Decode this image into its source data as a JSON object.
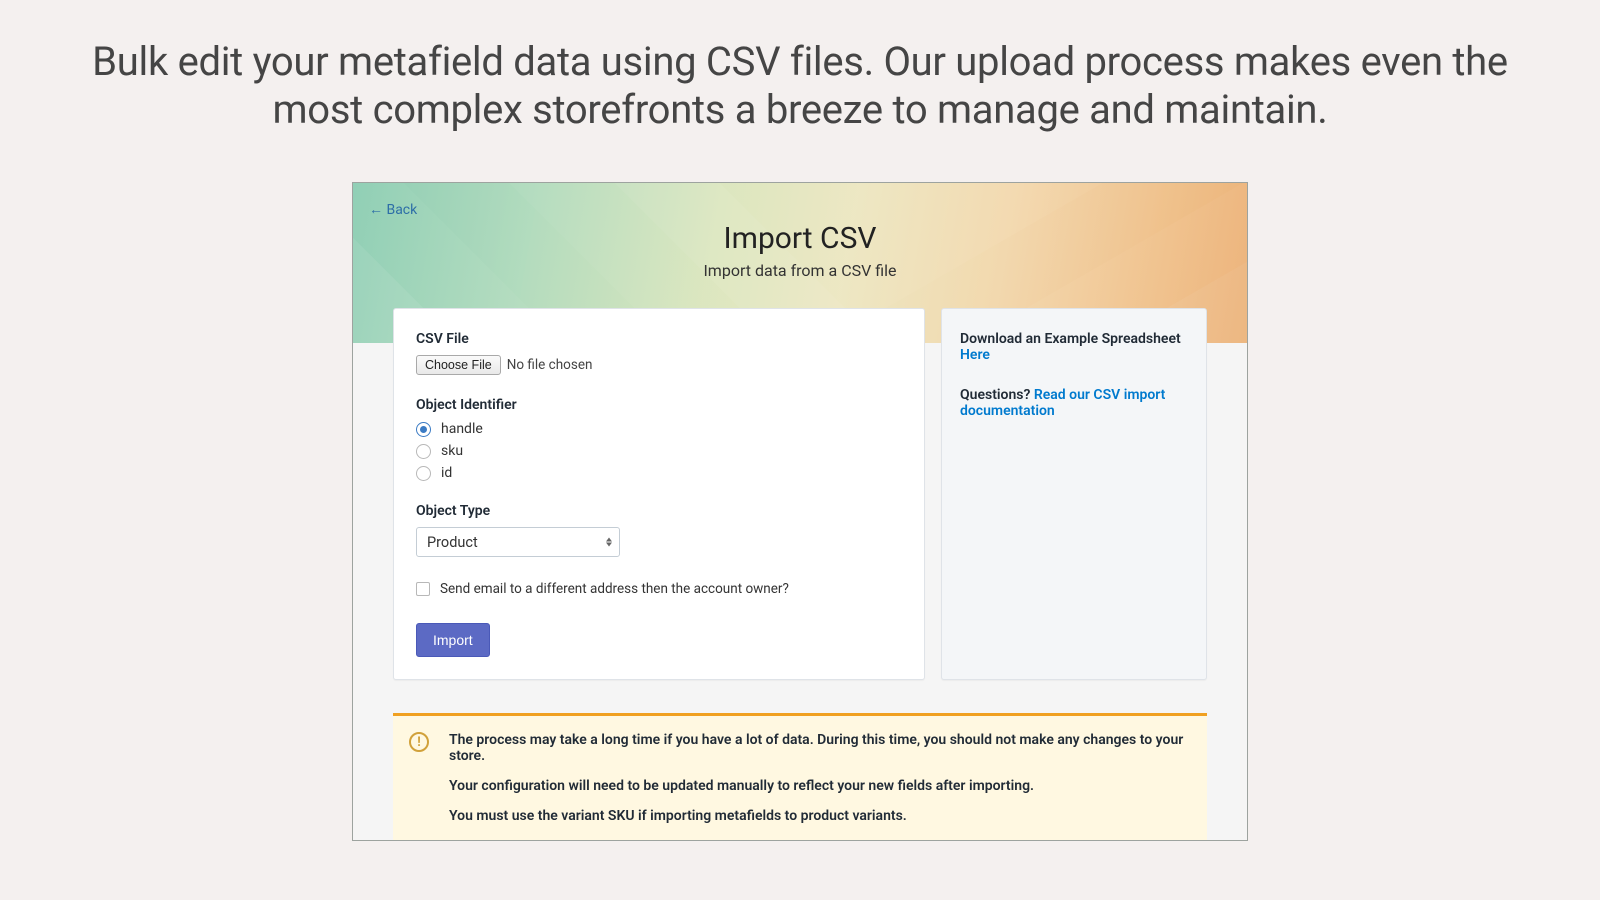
{
  "hero": {
    "text": "Bulk edit your metafield data using CSV files. Our upload process makes even the most complex storefronts a breeze to manage and maintain."
  },
  "header": {
    "back_label": "← Back",
    "title": "Import CSV",
    "subtitle": "Import data from a CSV file"
  },
  "form": {
    "csv_file_label": "CSV File",
    "choose_file_label": "Choose File",
    "file_status": "No file chosen",
    "object_identifier_label": "Object Identifier",
    "identifiers": [
      {
        "label": "handle",
        "checked": true
      },
      {
        "label": "sku",
        "checked": false
      },
      {
        "label": "id",
        "checked": false
      }
    ],
    "object_type_label": "Object Type",
    "object_type_value": "Product",
    "email_checkbox_label": "Send email to a different address then the account owner?",
    "import_button": "Import"
  },
  "sidebar": {
    "download_text": "Download an Example Spreadsheet ",
    "download_link": "Here",
    "questions_text": "Questions? ",
    "questions_link": "Read our CSV import documentation"
  },
  "warning": {
    "line1": "The process may take a long time if you have a lot of data. During this time, you should not make any changes to your store.",
    "line2": "Your configuration will need to be updated manually to reflect your new fields after importing.",
    "line3": "You must use the variant SKU if importing metafields to product variants."
  }
}
